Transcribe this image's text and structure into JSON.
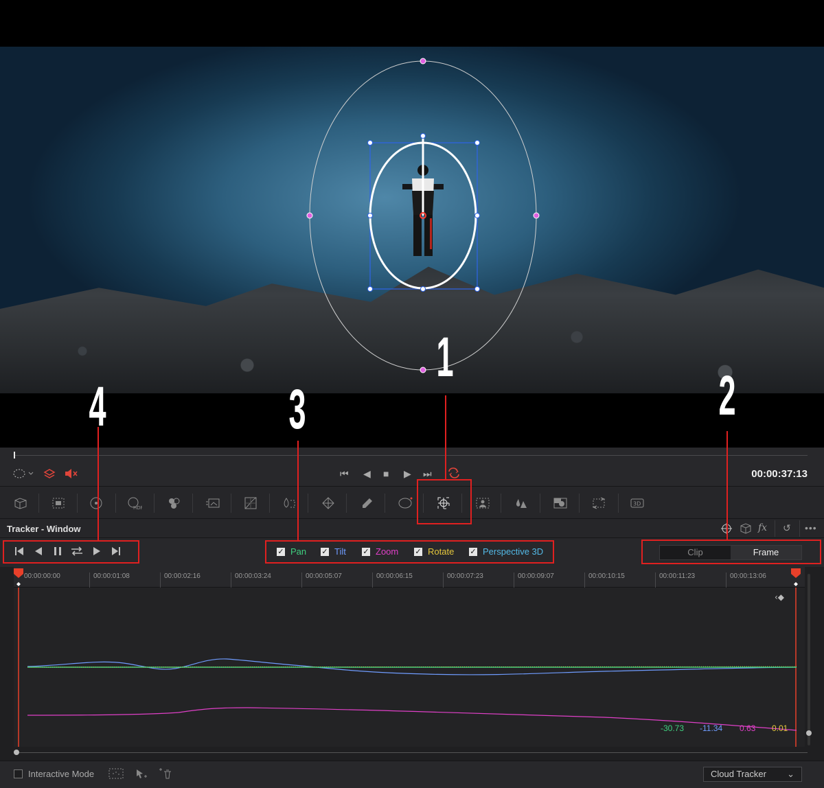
{
  "callouts": [
    "1",
    "2",
    "3",
    "4"
  ],
  "transport": {
    "timecode": "00:00:37:13"
  },
  "palette": {
    "title": "Tracker - Window",
    "fx_label": "fx"
  },
  "tracking_controls": {
    "checkboxes": [
      {
        "label": "Pan",
        "checked": true,
        "color": "#3fd07f"
      },
      {
        "label": "Tilt",
        "checked": true,
        "color": "#6f9cff"
      },
      {
        "label": "Zoom",
        "checked": true,
        "color": "#e040c8"
      },
      {
        "label": "Rotate",
        "checked": true,
        "color": "#e6c83c"
      },
      {
        "label": "Perspective 3D",
        "checked": true,
        "color": "#53b9e6"
      }
    ],
    "mode": {
      "options": [
        "Clip",
        "Frame"
      ],
      "selected": "Frame"
    }
  },
  "timeline": {
    "ticks": [
      "00:00:00:00",
      "00:00:01:08",
      "00:00:02:16",
      "00:00:03:24",
      "00:00:05:07",
      "00:00:06:15",
      "00:00:07:23",
      "00:00:09:07",
      "00:00:10:15",
      "00:00:11:23",
      "00:00:13:06"
    ]
  },
  "readouts": [
    {
      "value": "-30.73",
      "color": "#3fd07f"
    },
    {
      "value": "-11.34",
      "color": "#6f9cff"
    },
    {
      "value": "0.63",
      "color": "#e040c8"
    },
    {
      "value": "0.01",
      "color": "#e6c83c"
    }
  ],
  "footer": {
    "interactive_mode_label": "Interactive Mode",
    "interactive_mode_checked": false,
    "tracker_select": "Cloud Tracker"
  },
  "colors": {
    "highlight_red": "#e02020",
    "playhead": "#e8402a",
    "pan": "#3fd07f",
    "tilt": "#6f9cff",
    "zoom": "#e040c8"
  },
  "icons": {
    "transport": [
      "skip-to-start-icon",
      "play-reverse-icon",
      "stop-icon",
      "play-icon",
      "skip-to-end-icon",
      "loop-icon"
    ],
    "tools": [
      "camera-raw-icon",
      "color-match-icon",
      "primaries-icon",
      "hdr-icon",
      "rgb-mixer-icon",
      "motion-effects-icon",
      "curves-icon",
      "color-warper-icon",
      "qualifier-icon",
      "window-icon",
      "tracker-icon",
      "magic-mask-icon",
      "blur-icon",
      "key-icon",
      "sizing-icon",
      "3d-icon"
    ]
  }
}
